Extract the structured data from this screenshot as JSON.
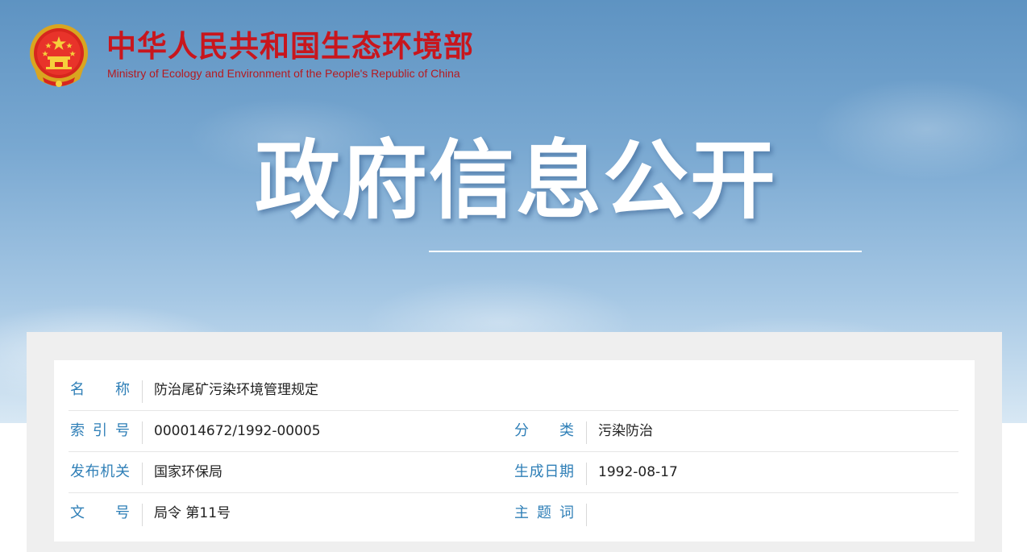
{
  "header": {
    "ministry_cn": "中华人民共和国生态环境部",
    "ministry_en": "Ministry of Ecology and Environment of the People's Republic of China",
    "page_title": "政府信息公开",
    "brand_color": "#c8161d"
  },
  "info": {
    "name_label": "名　　称",
    "name_value": "防治尾矿污染环境管理规定",
    "index_label": "索 引 号",
    "index_value": "000014672/1992-00005",
    "category_label": "分　　类",
    "category_value": "污染防治",
    "issuer_label": "发布机关",
    "issuer_value": "国家环保局",
    "date_label": "生成日期",
    "date_value": "1992-08-17",
    "docno_label": "文　　号",
    "docno_value": "局令 第11号",
    "keywords_label": "主 题 词",
    "keywords_value": "",
    "label_color": "#2f7fb7"
  }
}
